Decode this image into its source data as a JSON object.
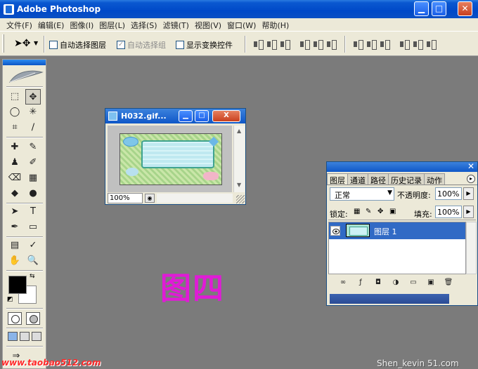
{
  "app": {
    "title": "Adobe Photoshop",
    "min": "▁",
    "max": "□",
    "close": "✕"
  },
  "menu": [
    "文件(F)",
    "编辑(E)",
    "图像(I)",
    "图层(L)",
    "选择(S)",
    "滤镜(T)",
    "视图(V)",
    "窗口(W)",
    "帮助(H)"
  ],
  "options": {
    "tool_icon": "move-tool-icon",
    "auto_select_layer": "自动选择图层",
    "auto_select_group": "自动选择组",
    "show_transform": "显示变换控件",
    "auto_select_group_checked": "✓"
  },
  "toolbox": {
    "tools": [
      "⬚",
      "✥",
      "◯",
      "✳",
      "⌗",
      "∕",
      "✚",
      "✎",
      "♟",
      "✐",
      "⌫",
      "▦",
      "◆",
      "●",
      "➤",
      "T",
      "✒",
      "▭",
      "▤",
      "✓",
      "✋",
      "🔍"
    ]
  },
  "document": {
    "name": "H032.gif...",
    "zoom": "100%",
    "close": "X",
    "min": "▁",
    "max": "□"
  },
  "layers_palette": {
    "tabs": [
      "图层",
      "通道",
      "路径",
      "历史记录",
      "动作"
    ],
    "blend_mode": "正常",
    "opacity_label": "不透明度:",
    "opacity_value": "100%",
    "lock_label": "锁定:",
    "fill_label": "填充:",
    "fill_value": "100%",
    "layer_name": "图层 1",
    "close": "✕",
    "menu": "▸"
  },
  "caption": "图四",
  "watermarks": {
    "left": "www.taobao512.com",
    "right": "Shen_kevin 51.com"
  }
}
